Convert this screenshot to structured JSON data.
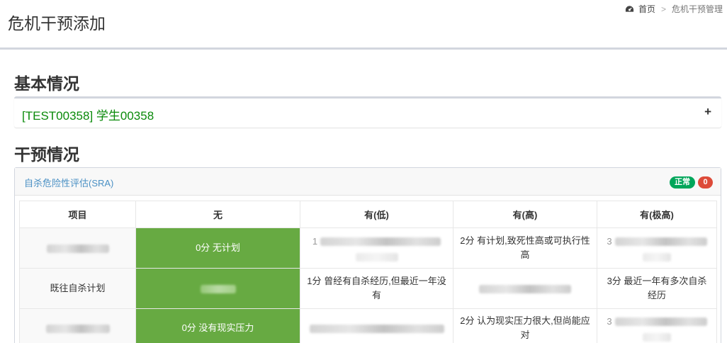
{
  "header": {
    "title": "危机干预添加",
    "breadcrumb": {
      "home": "首页",
      "separator": ">",
      "current": "危机干预管理"
    }
  },
  "sections": {
    "basic": "基本情况",
    "intervention": "干预情况"
  },
  "student": {
    "name": "[TEST00358] 学生00358",
    "expand_label": "+"
  },
  "sra": {
    "title": "自杀危险性评估(SRA)",
    "status_label": "正常",
    "score_badge": "0",
    "columns": [
      "项目",
      "无",
      "有(低)",
      "有(高)",
      "有(极高)"
    ],
    "rows": [
      {
        "item": "",
        "none": "0分 无计划",
        "low": "1",
        "high": "2分 有计划,致死性高或可执行性高",
        "extreme": "3"
      },
      {
        "item": "既往自杀计划",
        "none": "",
        "low": "1分 曾经有自杀经历,但最近一年没有",
        "high": "",
        "extreme": "3分 最近一年有多次自杀经历"
      },
      {
        "item": "",
        "none": "0分 没有现实压力",
        "low": "",
        "high": "2分 认为现实压力很大,但尚能应对",
        "extreme": "3"
      }
    ]
  },
  "colors": {
    "selected": "#67aa42",
    "success": "#00a65a",
    "danger": "#dd4b39",
    "link": "#4a90c4",
    "student": "#0a8a0a"
  }
}
